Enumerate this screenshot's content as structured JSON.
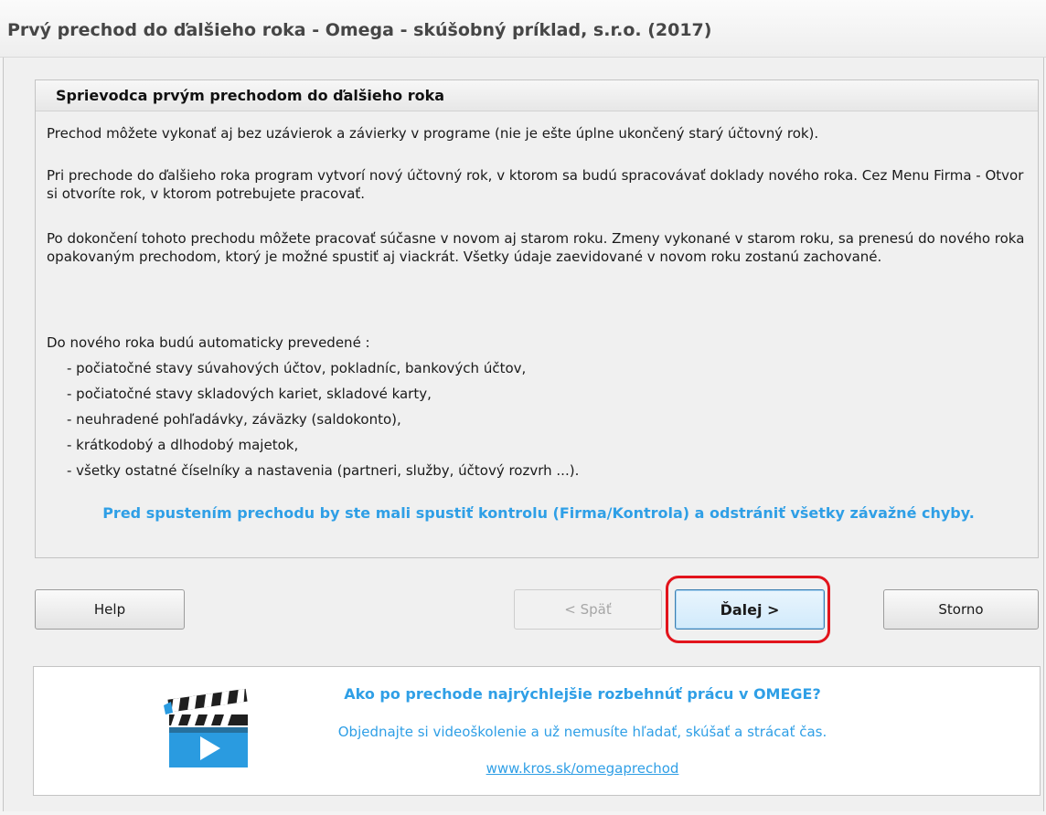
{
  "window": {
    "title": "Prvý prechod do ďalšieho roka - Omega - skúšobný príklad, s.r.o. (2017)"
  },
  "wizard": {
    "heading": "Sprievodca prvým prechodom do ďalšieho roka",
    "paragraph1": "Prechod môžete vykonať aj bez uzávierok a závierky v programe (nie je ešte úplne ukončený starý účtovný rok).",
    "paragraph2": "Pri prechode do ďalšieho roka program vytvorí nový účtovný rok, v ktorom sa budú spracovávať doklady nového roka. Cez Menu Firma - Otvor si otvoríte rok, v ktorom potrebujete pracovať.",
    "paragraph3": "Po dokončení tohoto prechodu môžete pracovať súčasne v novom aj starom roku. Zmeny vykonané v starom roku, sa prenesú do nového roka opakovaným prechodom, ktorý je možné spustiť aj viackrát. Všetky údaje zaevidované v novom roku zostanú zachované.",
    "list_intro": "Do nového roka budú automaticky prevedené :",
    "items": [
      "- počiatočné stavy súvahových účtov, pokladníc, bankových účtov,",
      "- počiatočné stavy skladových kariet, skladové karty,",
      "- neuhradené pohľadávky, záväzky (saldokonto),",
      "- krátkodobý a dlhodobý majetok,",
      "- všetky ostatné číselníky a nastavenia (partneri, služby, účtový rozvrh ...)."
    ],
    "warning": "Pred spustením prechodu by ste mali spustiť kontrolu (Firma/Kontrola) a odstrániť všetky závažné chyby."
  },
  "buttons": {
    "help": "Help",
    "back": "< Späť",
    "next": "Ďalej >",
    "cancel": "Storno"
  },
  "promo": {
    "headline": "Ako po prechode najrýchlejšie rozbehnúť prácu v OMEGE?",
    "subtext": "Objednajte si videoškolenie a už nemusíte hľadať, skúšať a strácať čas.",
    "link": "www.kros.sk/omegaprechod",
    "icon": "video-clapperboard-icon"
  },
  "colors": {
    "accent_blue": "#2f9fe6",
    "highlight_red": "#e2141c",
    "primary_button": "#d1eafb"
  }
}
